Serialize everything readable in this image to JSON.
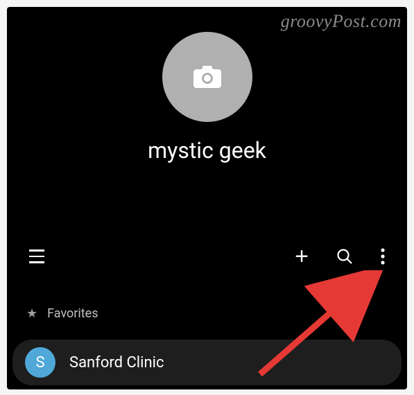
{
  "watermark": "groovyPost.com",
  "profile": {
    "name": "mystic geek"
  },
  "favorites": {
    "label": "Favorites"
  },
  "contacts": [
    {
      "initial": "S",
      "name": "Sanford Clinic"
    }
  ]
}
